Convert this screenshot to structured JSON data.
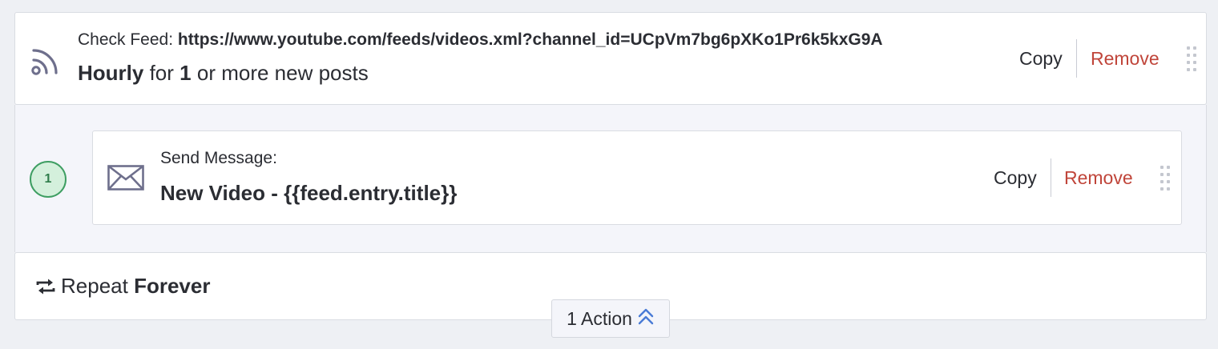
{
  "trigger": {
    "icon": "rss-feed-icon",
    "label": "Check Feed:",
    "url": "https://www.youtube.com/feeds/videos.xml?channel_id=UCpVm7bg6pXKo1Pr6k5kxG9A",
    "frequency": "Hourly",
    "for_text": "for",
    "count": "1",
    "suffix": "or more new posts",
    "copy_label": "Copy",
    "remove_label": "Remove"
  },
  "actions": [
    {
      "number": "1",
      "icon": "envelope-icon",
      "label": "Send Message:",
      "value": "New Video - {{feed.entry.title}}",
      "copy_label": "Copy",
      "remove_label": "Remove"
    }
  ],
  "repeat": {
    "icon": "repeat-icon",
    "label": "Repeat",
    "value": "Forever"
  },
  "actions_toggle": {
    "label": "1 Action",
    "icon": "chevron-double-up-icon"
  },
  "colors": {
    "remove": "#c0453a",
    "step_badge_bg": "#d4f0dc",
    "step_badge_border": "#3e9e62",
    "toggle_chevron": "#4a7bd6"
  }
}
